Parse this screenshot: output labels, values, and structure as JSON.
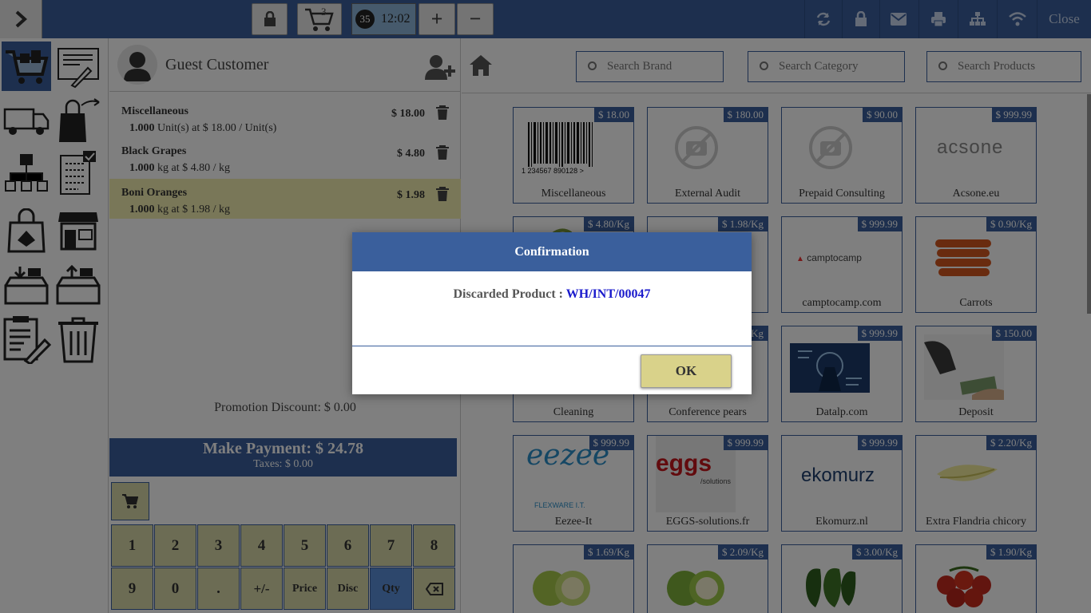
{
  "topbar": {
    "cart_count": "3",
    "orders_badge": "35",
    "clock": "12:02",
    "plus_label": "+",
    "minus_label": "−",
    "close_label": "Close"
  },
  "customer": {
    "name": "Guest Customer"
  },
  "order_lines": [
    {
      "name": "Miscellaneous",
      "detail_qty": "1.000",
      "detail": " Unit(s) at $ 18.00 / Unit(s)",
      "price": "$ 18.00"
    },
    {
      "name": "Black Grapes",
      "detail_qty": "1.000",
      "detail": " kg at $ 4.80 / kg",
      "price": "$ 4.80"
    },
    {
      "name": "Boni Oranges",
      "detail_qty": "1.000",
      "detail": " kg at $ 1.98 / kg",
      "price": "$ 1.98"
    }
  ],
  "promotion": "Promotion Discount: $ 0.00",
  "payment": {
    "label": "Make Payment: $ 24.78",
    "taxes": "Taxes: $ 0.00"
  },
  "keypad": [
    "1",
    "2",
    "3",
    "4",
    "5",
    "6",
    "7",
    "8",
    "9",
    "0",
    ".",
    "+/-",
    "Price",
    "Disc",
    "Qty"
  ],
  "search": {
    "brand": "Search Brand",
    "category": "Search Category",
    "products": "Search Products"
  },
  "products": [
    {
      "name": "Miscellaneous",
      "price": "$ 18.00"
    },
    {
      "name": "External Audit",
      "price": "$ 180.00"
    },
    {
      "name": "Prepaid Consulting",
      "price": "$ 90.00"
    },
    {
      "name": "Acsone.eu",
      "price": "$ 999.99"
    },
    {
      "name": "",
      "price": "$ 4.80/Kg"
    },
    {
      "name": "",
      "price": "$ 1.98/Kg"
    },
    {
      "name": "camptocamp.com",
      "price": "$ 999.99"
    },
    {
      "name": "Carrots",
      "price": "$ 0.90/Kg"
    },
    {
      "name": "Cleaning",
      "price": ""
    },
    {
      "name": "Conference pears",
      "price": "Kg"
    },
    {
      "name": "Datalp.com",
      "price": "$ 999.99"
    },
    {
      "name": "Deposit",
      "price": "$ 150.00"
    },
    {
      "name": "Eezee-It",
      "price": "$ 999.99"
    },
    {
      "name": "EGGS-solutions.fr",
      "price": "$ 999.99"
    },
    {
      "name": "Ekomurz.nl",
      "price": "$ 999.99"
    },
    {
      "name": "Extra Flandria chicory",
      "price": "$ 2.20/Kg"
    },
    {
      "name": "",
      "price": "$ 1.69/Kg"
    },
    {
      "name": "",
      "price": "$ 2.09/Kg"
    },
    {
      "name": "",
      "price": "$ 3.00/Kg"
    },
    {
      "name": "",
      "price": "$ 1.90/Kg"
    }
  ],
  "logos": {
    "acsone": "acsone",
    "camptocamp": "camptocamp",
    "eezee": "eezee",
    "eezee_sub": "FLEXWARE I.T.",
    "eggs": "eggs",
    "eggs_sub": "/solutions",
    "ekomurz": "ekomurz",
    "barcode_digits": "1 234567 890128 >"
  },
  "dialog": {
    "title": "Confirmation",
    "message": "Discarded Product : ",
    "reference": "WH/INT/00047",
    "ok_label": "OK"
  },
  "colors": {
    "primary": "#3a5f9c",
    "keypad": "#d9d9a8",
    "selected_line": "#f2efb0",
    "qty_key": "#5b8fd8"
  }
}
